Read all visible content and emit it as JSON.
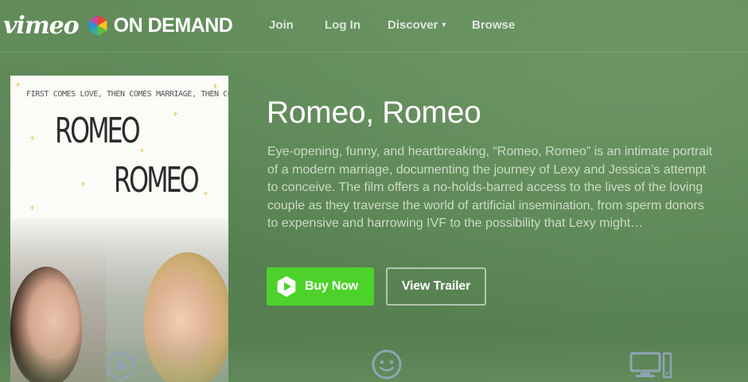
{
  "header": {
    "logo_wordmark": "vimeo",
    "logo_subbrand": "ON DEMAND",
    "nav": {
      "join": "Join",
      "login": "Log In",
      "discover": "Discover",
      "browse": "Browse"
    }
  },
  "poster": {
    "tagline": "FIRST COMES LOVE, THEN COMES MARRIAGE, THEN COMES . . .",
    "title_line1": "ROMEO",
    "title_line2": "ROMEO"
  },
  "film": {
    "title": "Romeo, Romeo",
    "description": "Eye-opening, funny, and heartbreaking, “Romeo, Romeo” is an intimate portrait of a modern marriage, documenting the journey of Lexy and Jessica’s attempt to conceive. The film offers a no-holds-barred access to the lives of the loving couple as they traverse the world of artificial insemination, from sperm donors to expensive and harrowing IVF to the possibility that Lexy might…"
  },
  "actions": {
    "buy_label": "Buy Now",
    "trailer_label": "View Trailer"
  },
  "features": {
    "icons": [
      "play-hexagon-icon",
      "smiley-face-icon",
      "devices-icon"
    ]
  },
  "colors": {
    "background": "#5e8a58",
    "buy_button": "#4cd22a",
    "logo_hex_red": "#e8442e",
    "logo_hex_blue": "#2f8fd7",
    "logo_hex_yellow": "#f6c325",
    "logo_hex_green": "#5fbf3a"
  }
}
